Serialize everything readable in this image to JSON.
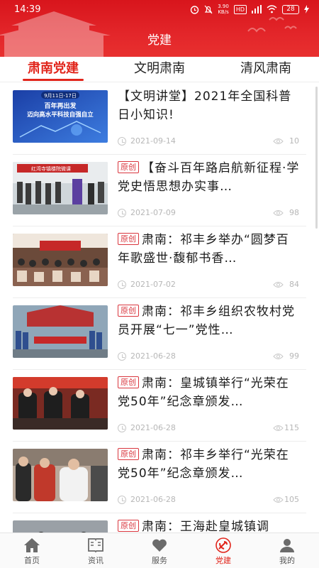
{
  "status": {
    "time": "14:39",
    "net_speed": "3.90",
    "net_unit": "KB/s",
    "hd": "HD",
    "battery": "28"
  },
  "header": {
    "title": "党建"
  },
  "tabs": [
    {
      "label": "肃南党建",
      "active": true
    },
    {
      "label": "文明肃南",
      "active": false
    },
    {
      "label": "清风肃南",
      "active": false
    }
  ],
  "articles": [
    {
      "tag": "",
      "title": "【文明讲堂】2021年全国科普日小知识!",
      "date": "2021-09-14",
      "views": "10",
      "thumb_text_1": "9月11日-17日",
      "thumb_text_2": "百年再出发",
      "thumb_text_3": "迈向高水平科技自强自立"
    },
    {
      "tag": "原创",
      "title": "【奋斗百年路启航新征程·学党史悟思想办实事…",
      "date": "2021-07-09",
      "views": "98",
      "thumb_text_1": "红湾寺镇楼院微课"
    },
    {
      "tag": "原创",
      "title": "肃南：祁丰乡举办“圆梦百年歌盛世·馥郁书香…",
      "date": "2021-07-02",
      "views": "84"
    },
    {
      "tag": "原创",
      "title": "肃南：祁丰乡组织农牧村党员开展“七一”党性…",
      "date": "2021-06-28",
      "views": "99"
    },
    {
      "tag": "原创",
      "title": "肃南：皇城镇举行“光荣在党50年”纪念章颁发…",
      "date": "2021-06-28",
      "views": "115"
    },
    {
      "tag": "原创",
      "title": "肃南：祁丰乡举行“光荣在党50年”纪念章颁发…",
      "date": "2021-06-28",
      "views": "105"
    },
    {
      "tag": "原创",
      "title": "肃南：王海赴皇城镇调",
      "date": "",
      "views": ""
    }
  ],
  "bottom_nav": [
    {
      "label": "首页",
      "icon": "home-icon",
      "active": false
    },
    {
      "label": "资讯",
      "icon": "news-icon",
      "active": false
    },
    {
      "label": "服务",
      "icon": "heart-icon",
      "active": false
    },
    {
      "label": "党建",
      "icon": "party-emblem-icon",
      "active": true
    },
    {
      "label": "我的",
      "icon": "user-icon",
      "active": false
    }
  ],
  "colors": {
    "brand_red": "#e1251b",
    "header_red": "#d8151c",
    "meta_grey": "#b7b7b7"
  }
}
